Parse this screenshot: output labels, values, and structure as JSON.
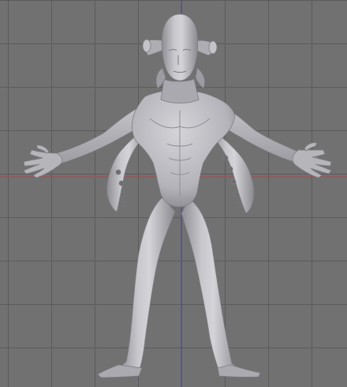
{
  "viewport": {
    "mode": "3d-viewport-front-orthographic",
    "grid_visible": true,
    "colors": {
      "background": "#717171",
      "grid_line": "#5b5b5b",
      "x_axis": "#b04848",
      "z_axis": "#4848b0",
      "mesh_fill": "#b9b9be",
      "mesh_shadow": "#7e7e84",
      "mesh_highlight": "#d6d6da",
      "mesh_outline": "#8a8a90"
    },
    "object": {
      "icon": "humanoid-creature-mesh-icon",
      "description_visible_text": ""
    }
  }
}
